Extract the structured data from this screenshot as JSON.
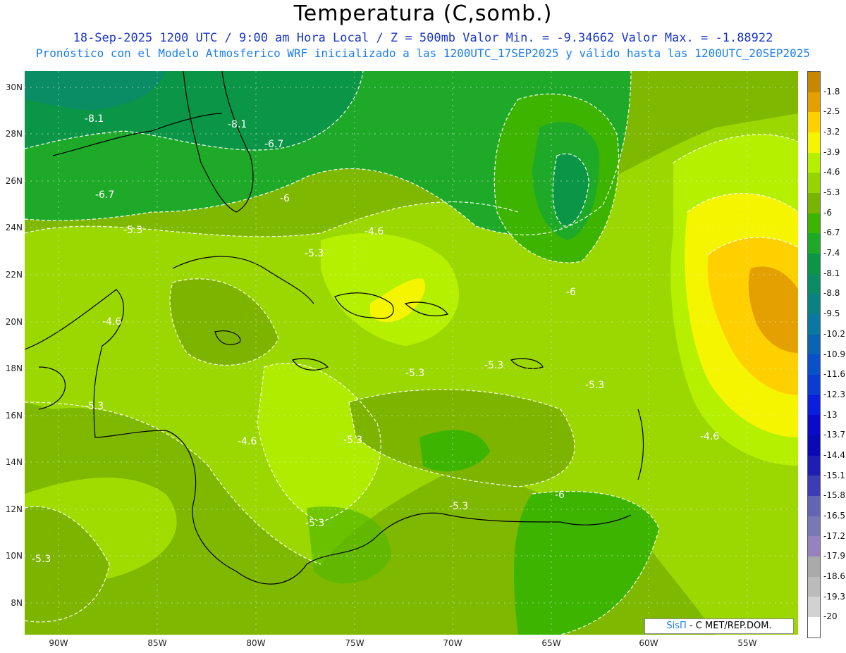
{
  "header": {
    "title": "Temperatura (C,somb.)",
    "subtitle1": "18-Sep-2025  1200 UTC / 9:00 am Hora Local / Z = 500mb  Valor Min. = -9.34662  Valor Max. = -1.88922",
    "subtitle2": "Pronóstico con el Modelo Atmosferico WRF inicializado a las 1200UTC_17SEP2025 y válido hasta las  1200UTC_20SEP2025"
  },
  "axes": {
    "lat_labels": [
      "30N",
      "28N",
      "26N",
      "24N",
      "22N",
      "20N",
      "18N",
      "16N",
      "14N",
      "12N",
      "10N",
      "8N"
    ],
    "lon_labels": [
      "90W",
      "85W",
      "80W",
      "75W",
      "70W",
      "65W",
      "60W",
      "55W"
    ]
  },
  "colorbar": {
    "labels": [
      "-1.8",
      "-2.5",
      "-3.2",
      "-3.9",
      "-4.6",
      "-5.3",
      "-6",
      "-6.7",
      "-7.4",
      "-8.1",
      "-8.8",
      "-9.5",
      "-10.2",
      "-10.9",
      "-11.6",
      "-12.3",
      "-13",
      "-13.7",
      "-14.4",
      "-15.1",
      "-15.8",
      "-16.5",
      "-17.2",
      "-17.9",
      "-18.6",
      "-19.3",
      "-20"
    ],
    "colors": [
      "#c88700",
      "#e4a000",
      "#ffd000",
      "#f5f500",
      "#b4f000",
      "#96d400",
      "#78b400",
      "#3cb400",
      "#1eaa28",
      "#0a9646",
      "#0a8c64",
      "#0a8282",
      "#0a78a0",
      "#0a64b4",
      "#0a50c8",
      "#0a3cd2",
      "#0a1edc",
      "#0a0ac8",
      "#0a0ab4",
      "#1e1eb4",
      "#3c3cb4",
      "#6464b4",
      "#7878b4",
      "#9682be",
      "#aaaaaa",
      "#bbbbbb",
      "#d2d2d2",
      "#ffffff"
    ]
  },
  "contour_labels": [
    "-8.1",
    "-8.1",
    "-6.7",
    "-6.7",
    "-6",
    "-5.3",
    "-4.6",
    "-5.3",
    "-6",
    "-4.6",
    "-5.3",
    "-5.3",
    "-5.3",
    "-5.3",
    "-4.6",
    "-5.3",
    "-4.6",
    "-6",
    "-5.3",
    "-5.3",
    "-5.3"
  ],
  "credit": {
    "part1": "SisΠ",
    "part2": "- C  MET/REP.DOM."
  }
}
